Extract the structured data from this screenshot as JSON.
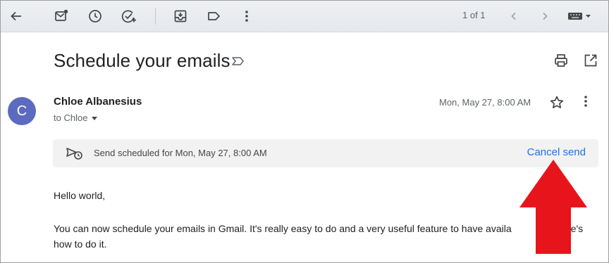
{
  "toolbar": {
    "icons": [
      "back-arrow-icon",
      "mark-unread-icon",
      "snooze-icon",
      "add-task-icon",
      "move-to-icon",
      "label-icon",
      "more-icon"
    ],
    "pager": "1 of 1",
    "input_tools": "keyboard-icon"
  },
  "email": {
    "subject": "Schedule your emails",
    "sender_initial": "C",
    "sender_name": "Chloe Albanesius",
    "recipient": "to Chloe",
    "date": "Mon, May 27, 8:00 AM"
  },
  "banner": {
    "text": "Send scheduled for Mon, May 27, 8:00 AM",
    "cancel_label": "Cancel send"
  },
  "body": {
    "greeting": "Hello world,",
    "paragraph_line1": "You can now schedule your emails in Gmail. It's really easy to do and a very useful feature to have availa",
    "paragraph_line1_end": "re's",
    "paragraph_line2": "how to do it."
  },
  "colors": {
    "accent": "#1a73e8",
    "avatar": "#5c6bc0",
    "annotation_arrow": "#e8141c"
  }
}
